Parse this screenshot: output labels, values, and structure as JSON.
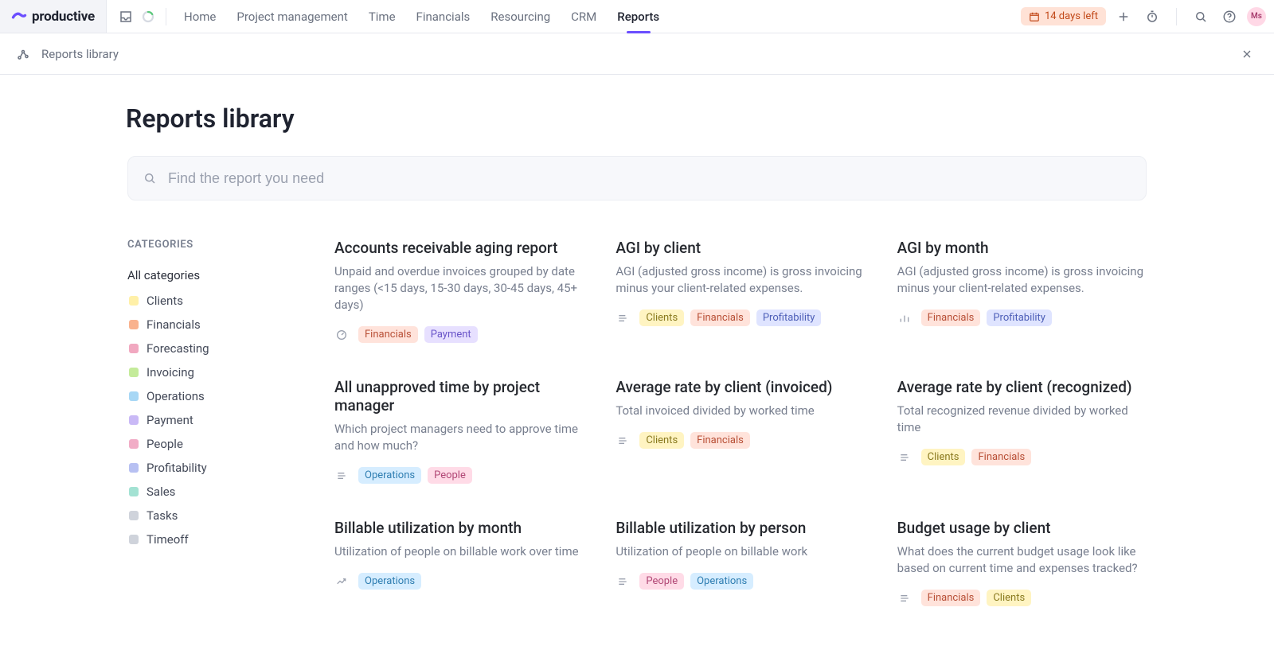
{
  "brand": "productive",
  "topnav": {
    "tabs": [
      "Home",
      "Project management",
      "Time",
      "Financials",
      "Resourcing",
      "CRM",
      "Reports"
    ],
    "active_tab_index": 6
  },
  "trial": {
    "label": "14 days left"
  },
  "avatar_initials": "Ms",
  "subheader": {
    "breadcrumb": "Reports library"
  },
  "page": {
    "title": "Reports library",
    "search_placeholder": "Find the report you need"
  },
  "categories_heading": "CATEGORIES",
  "categories": [
    {
      "name": "All categories",
      "color": null
    },
    {
      "name": "Clients",
      "color": "#fff0a8"
    },
    {
      "name": "Financials",
      "color": "#f9b28e"
    },
    {
      "name": "Forecasting",
      "color": "#f1a8c0"
    },
    {
      "name": "Invoicing",
      "color": "#c4eb9a"
    },
    {
      "name": "Operations",
      "color": "#a7d7f5"
    },
    {
      "name": "Payment",
      "color": "#c9b9f6"
    },
    {
      "name": "People",
      "color": "#f1acc6"
    },
    {
      "name": "Profitability",
      "color": "#b7c0f2"
    },
    {
      "name": "Sales",
      "color": "#a3e2d3"
    },
    {
      "name": "Tasks",
      "color": "#cfd3db"
    },
    {
      "name": "Timeoff",
      "color": "#cfd3db"
    }
  ],
  "reports": [
    {
      "icon": "gauge",
      "title": "Accounts receivable aging report",
      "desc": "Unpaid and overdue invoices grouped by date ranges (<15 days, 15-30 days, 30-45 days, 45+ days)",
      "tags": [
        "Financials",
        "Payment"
      ]
    },
    {
      "icon": "list",
      "title": "AGI by client",
      "desc": "AGI (adjusted gross income) is gross invoicing minus your client-related expenses.",
      "tags": [
        "Clients",
        "Financials",
        "Profitability"
      ]
    },
    {
      "icon": "bars",
      "title": "AGI by month",
      "desc": "AGI (adjusted gross income) is gross invoicing minus your client-related expenses.",
      "tags": [
        "Financials",
        "Profitability"
      ]
    },
    {
      "icon": "list",
      "title": "All unapproved time by project manager",
      "desc": "Which project managers need to approve time and how much?",
      "tags": [
        "Operations",
        "People"
      ]
    },
    {
      "icon": "list",
      "title": "Average rate by client (invoiced)",
      "desc": "Total invoiced divided by worked time",
      "tags": [
        "Clients",
        "Financials"
      ]
    },
    {
      "icon": "list",
      "title": "Average rate by client (recognized)",
      "desc": "Total recognized revenue divided by worked time",
      "tags": [
        "Clients",
        "Financials"
      ]
    },
    {
      "icon": "trend",
      "title": "Billable utilization by month",
      "desc": "Utilization of people on billable work over time",
      "tags": [
        "Operations"
      ]
    },
    {
      "icon": "list",
      "title": "Billable utilization by person",
      "desc": "Utilization of people on billable work",
      "tags": [
        "People",
        "Operations"
      ]
    },
    {
      "icon": "list",
      "title": "Budget usage by client",
      "desc": "What does the current budget usage look like based on current time and expenses tracked?",
      "tags": [
        "Financials",
        "Clients"
      ]
    }
  ]
}
